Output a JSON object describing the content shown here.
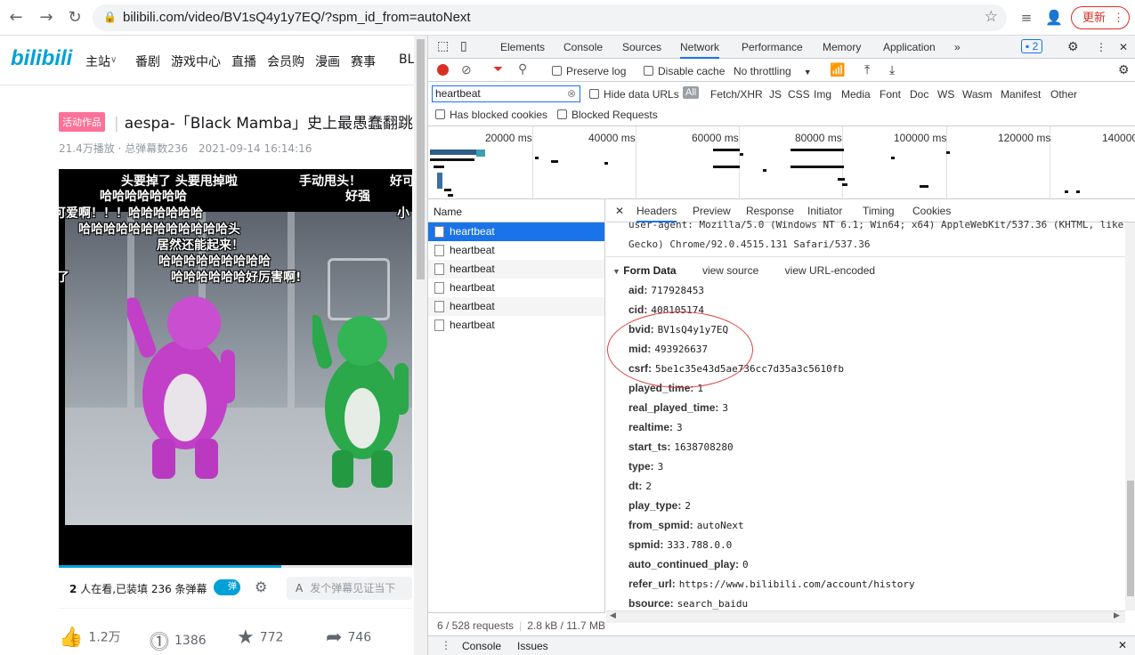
{
  "browser": {
    "url": "bilibili.com/video/BV1sQ4y1y7EQ/?spm_id_from=autoNext",
    "update_label": "更新"
  },
  "site": {
    "logo": "bilibili",
    "nav": [
      "主站",
      "番剧",
      "游戏中心",
      "直播",
      "会员购",
      "漫画",
      "赛事",
      "BL"
    ]
  },
  "video": {
    "tag": "活动作品",
    "title": "aespa-「Black Mamba」史上最愚蠢翻跳",
    "plays": "21.4万播放",
    "danmaku_total": "总弹幕数236",
    "date": "2021-09-14 16:14:16",
    "danmaku": [
      "头要掉了 头要甩掉啦",
      "手动甩头！",
      "好可",
      "哈哈哈哈哈哈哈",
      "好强",
      "可爱啊！！！哈哈哈哈哈哈",
      "小",
      "哈哈哈哈哈哈哈哈哈哈哈哈头",
      "居然还能起来！",
      "哈哈哈哈哈哈哈哈哈",
      "哈哈哈哈哈哈好厉害啊!",
      "了"
    ],
    "progress": 0.63,
    "watching_count": "2",
    "watching_text": "人在看,已装填 236 条弹幕",
    "danmaku_toggle": "弹",
    "danmaku_placeholder": "发个弹幕见证当下",
    "likes": "1.2万",
    "coins": "1386",
    "favorites": "772",
    "shares": "746"
  },
  "devtools": {
    "tabs": [
      "Elements",
      "Console",
      "Sources",
      "Network",
      "Performance",
      "Memory",
      "Application"
    ],
    "active_tab": "Network",
    "issues_badge": "2",
    "toolbar": {
      "preserve_log": "Preserve log",
      "disable_cache": "Disable cache",
      "throttling": "No throttling"
    },
    "filter_value": "heartbeat",
    "hide_data_urls": "Hide data URLs",
    "filter_types": [
      "All",
      "Fetch/XHR",
      "JS",
      "CSS",
      "Img",
      "Media",
      "Font",
      "Doc",
      "WS",
      "Wasm",
      "Manifest",
      "Other"
    ],
    "has_blocked_cookies": "Has blocked cookies",
    "blocked_requests": "Blocked Requests",
    "timeline_labels": [
      "20000 ms",
      "40000 ms",
      "60000 ms",
      "80000 ms",
      "100000 ms",
      "120000 ms",
      "140000"
    ],
    "name_header": "Name",
    "requests": [
      "heartbeat",
      "heartbeat",
      "heartbeat",
      "heartbeat",
      "heartbeat",
      "heartbeat"
    ],
    "status": "6 / 528 requests",
    "transfer": "2.8 kB / 11.7 MB",
    "detail_tabs": [
      "Headers",
      "Preview",
      "Response",
      "Initiator",
      "Timing",
      "Cookies"
    ],
    "user_agent_line1": "user-agent: Mozilla/5.0 (Windows NT 6.1; Win64; x64) AppleWebKit/537.36 (KHTML, like",
    "user_agent_line2": "Gecko) Chrome/92.0.4515.131 Safari/537.36",
    "form_data_title": "Form Data",
    "view_source": "view source",
    "view_url_encoded": "view URL-encoded",
    "form_data": [
      {
        "key": "aid:",
        "value": "717928453"
      },
      {
        "key": "cid:",
        "value": "408105174"
      },
      {
        "key": "bvid:",
        "value": "BV1sQ4y1y7EQ"
      },
      {
        "key": "mid:",
        "value": "493926637"
      },
      {
        "key": "csrf:",
        "value": "5be1c35e43d5ae736cc7d35a3c5610fb"
      },
      {
        "key": "played_time:",
        "value": "1"
      },
      {
        "key": "real_played_time:",
        "value": "3"
      },
      {
        "key": "realtime:",
        "value": "3"
      },
      {
        "key": "start_ts:",
        "value": "1638708280"
      },
      {
        "key": "type:",
        "value": "3"
      },
      {
        "key": "dt:",
        "value": "2"
      },
      {
        "key": "play_type:",
        "value": "2"
      },
      {
        "key": "from_spmid:",
        "value": "autoNext"
      },
      {
        "key": "spmid:",
        "value": "333.788.0.0"
      },
      {
        "key": "auto_continued_play:",
        "value": "0"
      },
      {
        "key": "refer_url:",
        "value": "https://www.bilibili.com/account/history"
      },
      {
        "key": "bsource:",
        "value": "search_baidu"
      }
    ],
    "drawer_tabs": [
      "Console",
      "Issues"
    ]
  },
  "colors": {
    "accent": "#1a73e8",
    "bili_blue": "#00a1d6",
    "bili_pink": "#fb7299",
    "annotation": "#e04040"
  }
}
